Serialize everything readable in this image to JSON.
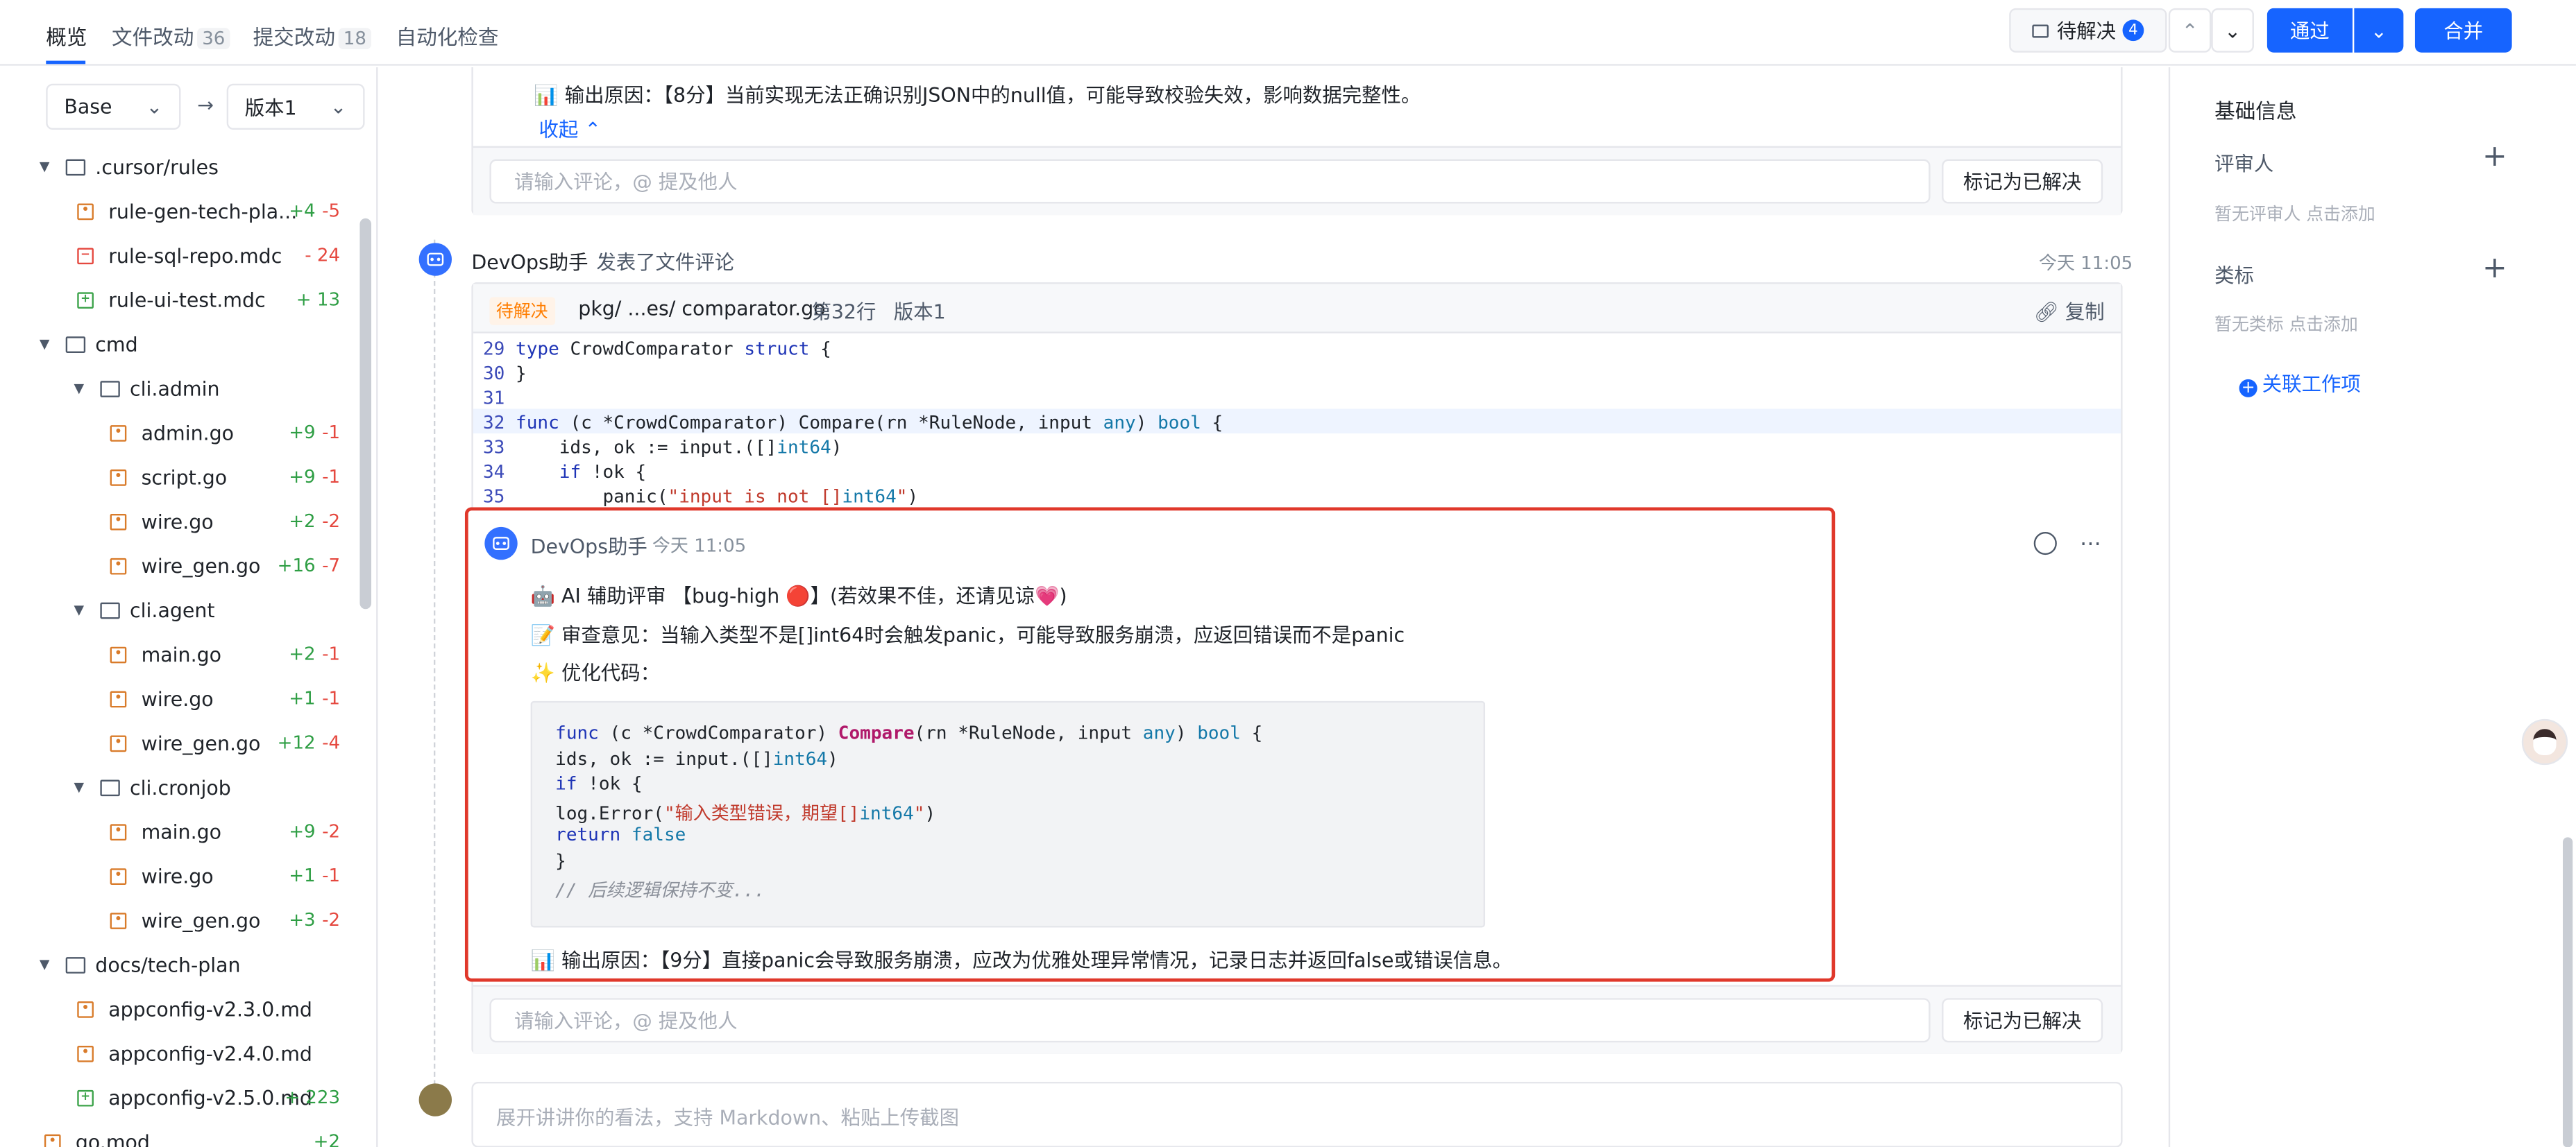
{
  "tabs": [
    {
      "label": "概览",
      "count": ""
    },
    {
      "label": "文件改动",
      "count": "36"
    },
    {
      "label": "提交改动",
      "count": "18"
    },
    {
      "label": "自动化检查",
      "count": ""
    }
  ],
  "topbar": {
    "pending_label": "待解决",
    "pending_count": "4",
    "approve_label": "通过",
    "merge_label": "合并"
  },
  "sidebar": {
    "base_label": "Base",
    "target_label": "版本1",
    "tree": [
      {
        "kind": "folder",
        "name": ".cursor/rules",
        "level": 0,
        "add": "",
        "del": ""
      },
      {
        "kind": "file",
        "status": "mod",
        "name": "rule-gen-tech-pla...",
        "level": 1,
        "add": "+4",
        "del": "-5"
      },
      {
        "kind": "file",
        "status": "del",
        "name": "rule-sql-repo.mdc",
        "level": 1,
        "add": "",
        "del": "- 24"
      },
      {
        "kind": "file",
        "status": "add",
        "name": "rule-ui-test.mdc",
        "level": 1,
        "add": "+ 13",
        "del": ""
      },
      {
        "kind": "folder",
        "name": "cmd",
        "level": 0,
        "add": "",
        "del": ""
      },
      {
        "kind": "folder",
        "name": "cli.admin",
        "level": 1,
        "add": "",
        "del": ""
      },
      {
        "kind": "file",
        "status": "mod",
        "name": "admin.go",
        "level": 2,
        "add": "+9",
        "del": "-1"
      },
      {
        "kind": "file",
        "status": "mod",
        "name": "script.go",
        "level": 2,
        "add": "+9",
        "del": "-1"
      },
      {
        "kind": "file",
        "status": "mod",
        "name": "wire.go",
        "level": 2,
        "add": "+2",
        "del": "-2"
      },
      {
        "kind": "file",
        "status": "mod",
        "name": "wire_gen.go",
        "level": 2,
        "add": "+16",
        "del": "-7"
      },
      {
        "kind": "folder",
        "name": "cli.agent",
        "level": 1,
        "add": "",
        "del": ""
      },
      {
        "kind": "file",
        "status": "mod",
        "name": "main.go",
        "level": 2,
        "add": "+2",
        "del": "-1"
      },
      {
        "kind": "file",
        "status": "mod",
        "name": "wire.go",
        "level": 2,
        "add": "+1",
        "del": "-1"
      },
      {
        "kind": "file",
        "status": "mod",
        "name": "wire_gen.go",
        "level": 2,
        "add": "+12",
        "del": "-4"
      },
      {
        "kind": "folder",
        "name": "cli.cronjob",
        "level": 1,
        "add": "",
        "del": ""
      },
      {
        "kind": "file",
        "status": "mod",
        "name": "main.go",
        "level": 2,
        "add": "+9",
        "del": "-2"
      },
      {
        "kind": "file",
        "status": "mod",
        "name": "wire.go",
        "level": 2,
        "add": "+1",
        "del": "-1"
      },
      {
        "kind": "file",
        "status": "mod",
        "name": "wire_gen.go",
        "level": 2,
        "add": "+3",
        "del": "-2"
      },
      {
        "kind": "folder",
        "name": "docs/tech-plan",
        "level": 0,
        "add": "",
        "del": ""
      },
      {
        "kind": "file",
        "status": "mod",
        "name": "appconfig-v2.3.0.md",
        "level": 1,
        "add": "",
        "del": ""
      },
      {
        "kind": "file",
        "status": "mod",
        "name": "appconfig-v2.4.0.md",
        "level": 1,
        "add": "",
        "del": ""
      },
      {
        "kind": "file",
        "status": "add",
        "name": "appconfig-v2.5.0.md",
        "level": 1,
        "add": "+ 223",
        "del": ""
      },
      {
        "kind": "file",
        "status": "mod",
        "name": "go.mod",
        "level": 0,
        "add": "+2",
        "del": ""
      }
    ]
  },
  "comment1": {
    "reason": "📊 输出原因：【8分】当前实现无法正确识别JSON中的null值，可能导致校验失效，影响数据完整性。",
    "collapse": "收起",
    "input_placeholder": "请输入评论，@ 提及他人",
    "resolve_label": "标记为已解决"
  },
  "comment2": {
    "author": "DevOps助手",
    "action": "发表了文件评论",
    "time": "今天 11:05",
    "status_tag": "待解决",
    "file_path": "pkg/ ...es/ comparator.go",
    "line": "第32行",
    "version": "版本1",
    "copy_label": "复制",
    "code_lines": [
      {
        "n": "29",
        "text": "type CrowdComparator struct {"
      },
      {
        "n": "30",
        "text": "}"
      },
      {
        "n": "31",
        "text": ""
      },
      {
        "n": "32",
        "text": "func (c *CrowdComparator) Compare(rn *RuleNode, input any) bool {"
      },
      {
        "n": "33",
        "text": "    ids, ok := input.([]int64)"
      },
      {
        "n": "34",
        "text": "    if !ok {"
      },
      {
        "n": "35",
        "text": "        panic(\"input is not []int64\")"
      }
    ],
    "reply": {
      "author": "DevOps助手",
      "time": "今天 11:05",
      "line1": "🤖 AI 辅助评审 【bug-high 🔴】(若效果不佳，还请见谅💗)",
      "line2": "📝 审查意见：当输入类型不是[]int64时会触发panic，可能导致服务崩溃，应返回错误而不是panic",
      "line3": "✨ 优化代码：",
      "code": [
        "func (c *CrowdComparator) Compare(rn *RuleNode, input any) bool {",
        "ids, ok := input.([]int64)",
        "if !ok {",
        "log.Error(\"输入类型错误，期望[]int64\")",
        "return false",
        "}",
        "// 后续逻辑保持不变..."
      ],
      "reason": "📊 输出原因：【9分】直接panic会导致服务崩溃，应改为优雅处理异常情况，记录日志并返回false或错误信息。"
    },
    "input_placeholder": "请输入评论，@ 提及他人",
    "resolve_label": "标记为已解决"
  },
  "bottom_input_placeholder": "展开讲讲你的看法，支持 Markdown、粘贴上传截图",
  "right_panel": {
    "title": "基础信息",
    "reviewers_label": "评审人",
    "reviewers_empty": "暂无评审人 点击添加",
    "tags_label": "类标",
    "tags_empty": "暂无类标 点击添加",
    "link_work_item": "关联工作项"
  },
  "colors": {
    "accent": "#1664ff",
    "highlight_border": "#e0382b",
    "pending_tag": "#ff7d00"
  }
}
